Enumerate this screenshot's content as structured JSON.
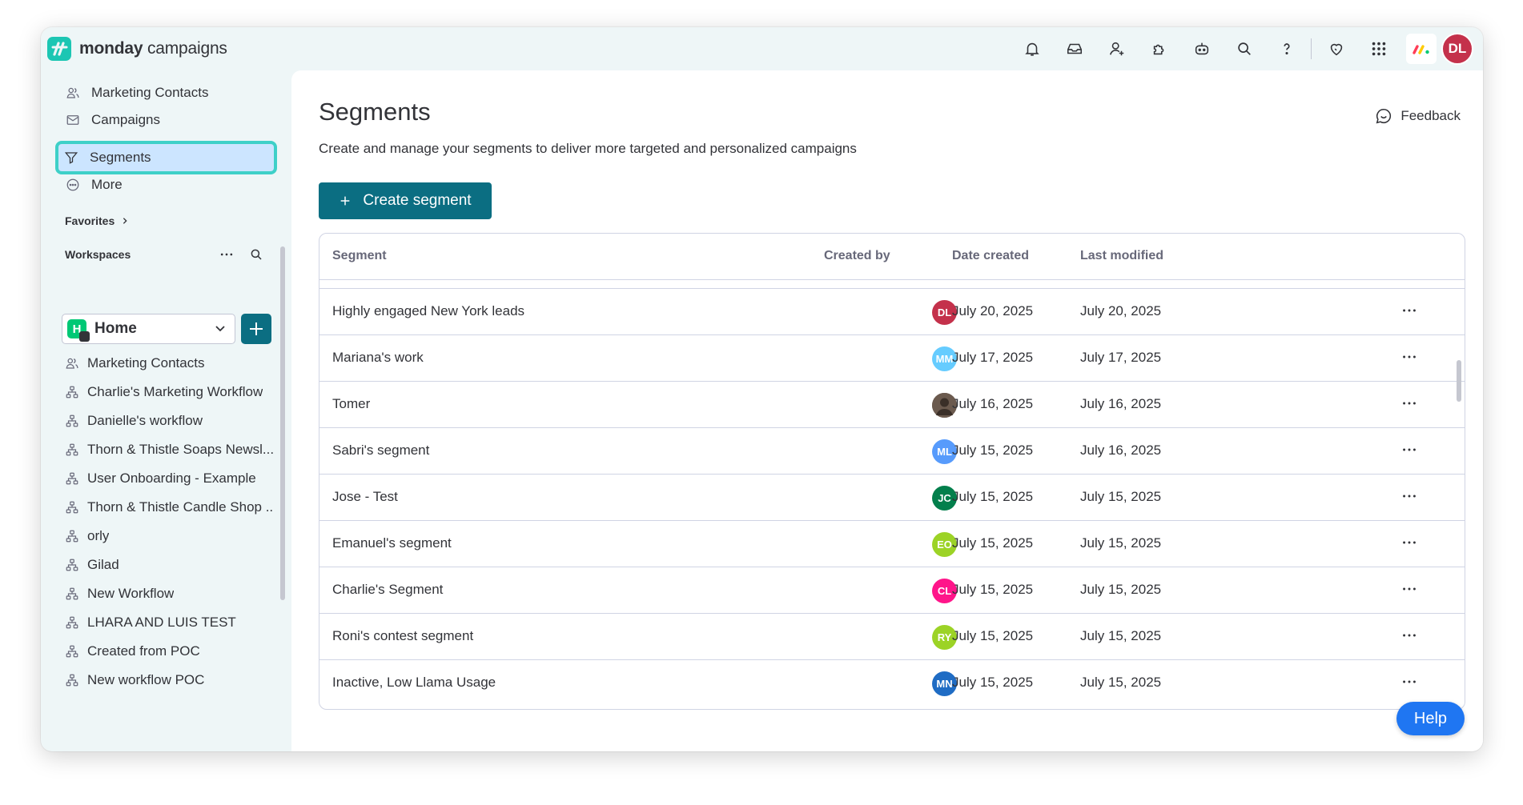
{
  "app": {
    "brand_bold": "monday",
    "brand_light": "campaigns",
    "user_initials": "DL",
    "user_color": "#c4314b"
  },
  "topbar": {
    "icons": [
      "bell-icon",
      "inbox-icon",
      "invite-user-icon",
      "apps-icon",
      "ai-assistant-icon",
      "search-icon",
      "help-icon",
      "heart-icon",
      "app-switcher-icon",
      "monday-brand-icon"
    ]
  },
  "sidebar": {
    "nav": [
      {
        "label": "Marketing Contacts",
        "icon": "contacts-icon"
      },
      {
        "label": "Campaigns",
        "icon": "mail-icon"
      },
      {
        "label": "Segments",
        "icon": "filter-icon",
        "active": true
      },
      {
        "label": "More",
        "icon": "more-circle-icon"
      }
    ],
    "favorites_label": "Favorites",
    "workspaces_label": "Workspaces",
    "workspace": {
      "name": "Home",
      "initial": "H",
      "color": "#00c875"
    },
    "items": [
      "Marketing Contacts",
      "Charlie's Marketing Workflow",
      "Danielle's workflow",
      "Thorn & Thistle Soaps Newsl...",
      "User Onboarding - Example",
      "Thorn & Thistle Candle Shop ...",
      "orly",
      "Gilad",
      "New Workflow",
      "LHARA AND LUIS TEST",
      "Created from POC",
      "New workflow POC"
    ]
  },
  "main": {
    "title": "Segments",
    "subtitle": "Create and manage your segments to deliver more targeted and personalized campaigns",
    "feedback_label": "Feedback",
    "create_label": "Create segment",
    "columns": [
      "Segment",
      "Created by",
      "Date created",
      "Last modified"
    ],
    "rows": [
      {
        "name": "Highly engaged New York leads",
        "initials": "DL",
        "color": "#c4314b",
        "created": "July 20, 2025",
        "modified": "July 20, 2025"
      },
      {
        "name": "Mariana's work",
        "initials": "MM",
        "color": "#66ccff",
        "created": "July 17, 2025",
        "modified": "July 17, 2025"
      },
      {
        "name": "Tomer",
        "initials": "",
        "color": "#6b5a4e",
        "photo": true,
        "created": "July 16, 2025",
        "modified": "July 16, 2025"
      },
      {
        "name": "Sabri's segment",
        "initials": "ML",
        "color": "#579bfc",
        "created": "July 15, 2025",
        "modified": "July 16, 2025"
      },
      {
        "name": "Jose - Test",
        "initials": "JC",
        "color": "#037f4c",
        "created": "July 15, 2025",
        "modified": "July 15, 2025"
      },
      {
        "name": "Emanuel's segment",
        "initials": "EO",
        "color": "#9cd326",
        "created": "July 15, 2025",
        "modified": "July 15, 2025"
      },
      {
        "name": "Charlie's Segment",
        "initials": "CL",
        "color": "#ff158a",
        "created": "July 15, 2025",
        "modified": "July 15, 2025"
      },
      {
        "name": "Roni's contest segment",
        "initials": "RY",
        "color": "#9cd326",
        "created": "July 15, 2025",
        "modified": "July 15, 2025"
      },
      {
        "name": "Inactive, Low Llama Usage",
        "initials": "MN",
        "color": "#1f6cc4",
        "created": "July 15, 2025",
        "modified": "July 15, 2025"
      }
    ]
  },
  "help_label": "Help"
}
